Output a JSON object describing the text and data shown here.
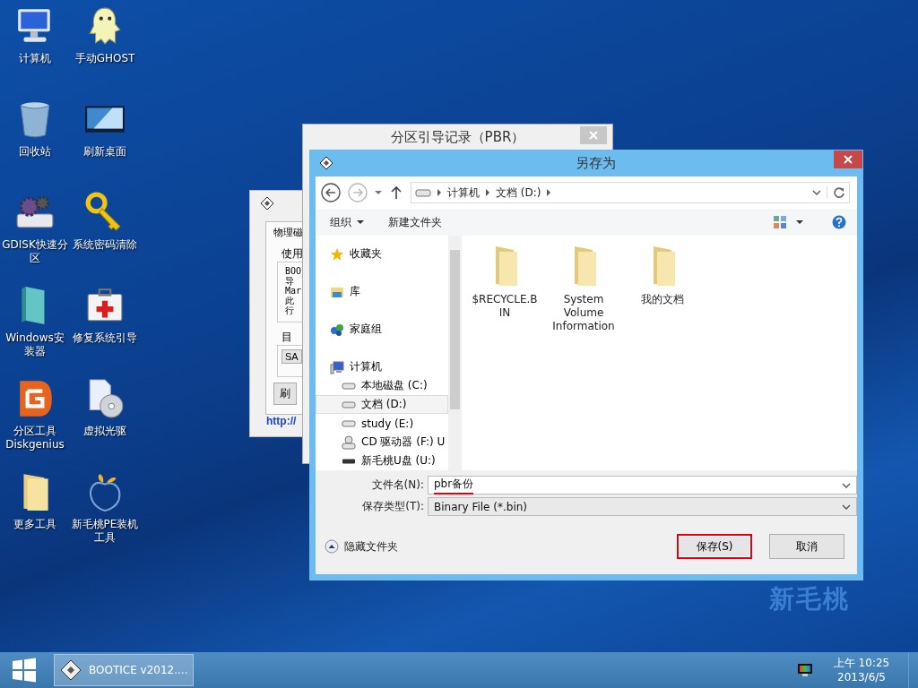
{
  "desktop_icons": [
    {
      "label": "计算机",
      "kind": "computer"
    },
    {
      "label": "手动GHOST",
      "kind": "ghost"
    },
    {
      "label": "回收站",
      "kind": "recycle"
    },
    {
      "label": "刷新桌面",
      "kind": "display"
    },
    {
      "label": "GDISK快速分区",
      "kind": "gears"
    },
    {
      "label": "系统密码清除",
      "kind": "key"
    },
    {
      "label": "Windows安装器",
      "kind": "box"
    },
    {
      "label": "修复系统引导",
      "kind": "firstaid"
    },
    {
      "label": "分区工具Diskgenius",
      "kind": "tile"
    },
    {
      "label": "虚拟光驱",
      "kind": "disc"
    },
    {
      "label": "更多工具",
      "kind": "folder"
    },
    {
      "label": "新毛桃PE装机工具",
      "kind": "peach"
    }
  ],
  "wallpaper_logo": "新毛桃",
  "bootice_window": {
    "tab": "物理磁",
    "group_1": "使用",
    "lines": [
      "BOO",
      "导",
      "Mar",
      "此",
      "行"
    ],
    "group_2": "目",
    "button_1": "SA",
    "button_2": "刷",
    "link": "http://"
  },
  "pbr_window": {
    "title": "分区引导记录（PBR）"
  },
  "save_dialog": {
    "title": "另存为",
    "breadcrumb": [
      "计算机",
      "文档 (D:)"
    ],
    "toolbar": {
      "organize": "组织",
      "new_folder": "新建文件夹"
    },
    "nav": [
      {
        "label": "收藏夹",
        "kind": "favorites",
        "selected": false
      },
      {
        "label": "库",
        "kind": "library",
        "selected": false
      },
      {
        "label": "家庭组",
        "kind": "homegroup",
        "selected": false
      },
      {
        "label": "计算机",
        "kind": "computer",
        "selected": false,
        "children": [
          {
            "label": "本地磁盘 (C:)",
            "kind": "drive",
            "selected": false
          },
          {
            "label": "文档 (D:)",
            "kind": "drive",
            "selected": true
          },
          {
            "label": "study (E:)",
            "kind": "drive",
            "selected": false
          },
          {
            "label": "CD 驱动器 (F:) U",
            "kind": "cd",
            "selected": false
          },
          {
            "label": "新毛桃U盘 (U:)",
            "kind": "usb",
            "selected": false
          }
        ]
      }
    ],
    "files": [
      {
        "name": "$RECYCLE.BIN"
      },
      {
        "name": "System Volume Information"
      },
      {
        "name": "我的文档"
      }
    ],
    "file_name": {
      "label": "文件名(N):",
      "value": "pbr备份",
      "underlined": true
    },
    "file_type": {
      "label": "保存类型(T):",
      "value": "Binary File (*.bin)"
    },
    "hide_folders": "隐藏文件夹",
    "buttons": [
      {
        "label": "保存(S)",
        "highlighted": true
      },
      {
        "label": "取消",
        "highlighted": false
      }
    ]
  },
  "taskbar": {
    "task": "BOOTICE v2012....",
    "time": "上午 10:25",
    "date": "2013/6/5"
  }
}
